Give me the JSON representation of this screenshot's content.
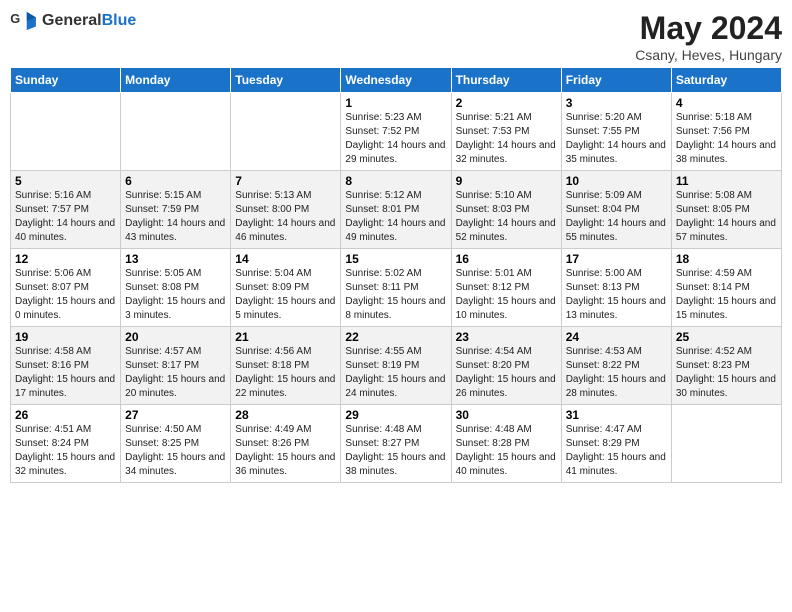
{
  "header": {
    "logo_general": "General",
    "logo_blue": "Blue",
    "month_year": "May 2024",
    "location": "Csany, Heves, Hungary"
  },
  "weekdays": [
    "Sunday",
    "Monday",
    "Tuesday",
    "Wednesday",
    "Thursday",
    "Friday",
    "Saturday"
  ],
  "weeks": [
    [
      {
        "day": "",
        "sunrise": "",
        "sunset": "",
        "daylight": ""
      },
      {
        "day": "",
        "sunrise": "",
        "sunset": "",
        "daylight": ""
      },
      {
        "day": "",
        "sunrise": "",
        "sunset": "",
        "daylight": ""
      },
      {
        "day": "1",
        "sunrise": "Sunrise: 5:23 AM",
        "sunset": "Sunset: 7:52 PM",
        "daylight": "Daylight: 14 hours and 29 minutes."
      },
      {
        "day": "2",
        "sunrise": "Sunrise: 5:21 AM",
        "sunset": "Sunset: 7:53 PM",
        "daylight": "Daylight: 14 hours and 32 minutes."
      },
      {
        "day": "3",
        "sunrise": "Sunrise: 5:20 AM",
        "sunset": "Sunset: 7:55 PM",
        "daylight": "Daylight: 14 hours and 35 minutes."
      },
      {
        "day": "4",
        "sunrise": "Sunrise: 5:18 AM",
        "sunset": "Sunset: 7:56 PM",
        "daylight": "Daylight: 14 hours and 38 minutes."
      }
    ],
    [
      {
        "day": "5",
        "sunrise": "Sunrise: 5:16 AM",
        "sunset": "Sunset: 7:57 PM",
        "daylight": "Daylight: 14 hours and 40 minutes."
      },
      {
        "day": "6",
        "sunrise": "Sunrise: 5:15 AM",
        "sunset": "Sunset: 7:59 PM",
        "daylight": "Daylight: 14 hours and 43 minutes."
      },
      {
        "day": "7",
        "sunrise": "Sunrise: 5:13 AM",
        "sunset": "Sunset: 8:00 PM",
        "daylight": "Daylight: 14 hours and 46 minutes."
      },
      {
        "day": "8",
        "sunrise": "Sunrise: 5:12 AM",
        "sunset": "Sunset: 8:01 PM",
        "daylight": "Daylight: 14 hours and 49 minutes."
      },
      {
        "day": "9",
        "sunrise": "Sunrise: 5:10 AM",
        "sunset": "Sunset: 8:03 PM",
        "daylight": "Daylight: 14 hours and 52 minutes."
      },
      {
        "day": "10",
        "sunrise": "Sunrise: 5:09 AM",
        "sunset": "Sunset: 8:04 PM",
        "daylight": "Daylight: 14 hours and 55 minutes."
      },
      {
        "day": "11",
        "sunrise": "Sunrise: 5:08 AM",
        "sunset": "Sunset: 8:05 PM",
        "daylight": "Daylight: 14 hours and 57 minutes."
      }
    ],
    [
      {
        "day": "12",
        "sunrise": "Sunrise: 5:06 AM",
        "sunset": "Sunset: 8:07 PM",
        "daylight": "Daylight: 15 hours and 0 minutes."
      },
      {
        "day": "13",
        "sunrise": "Sunrise: 5:05 AM",
        "sunset": "Sunset: 8:08 PM",
        "daylight": "Daylight: 15 hours and 3 minutes."
      },
      {
        "day": "14",
        "sunrise": "Sunrise: 5:04 AM",
        "sunset": "Sunset: 8:09 PM",
        "daylight": "Daylight: 15 hours and 5 minutes."
      },
      {
        "day": "15",
        "sunrise": "Sunrise: 5:02 AM",
        "sunset": "Sunset: 8:11 PM",
        "daylight": "Daylight: 15 hours and 8 minutes."
      },
      {
        "day": "16",
        "sunrise": "Sunrise: 5:01 AM",
        "sunset": "Sunset: 8:12 PM",
        "daylight": "Daylight: 15 hours and 10 minutes."
      },
      {
        "day": "17",
        "sunrise": "Sunrise: 5:00 AM",
        "sunset": "Sunset: 8:13 PM",
        "daylight": "Daylight: 15 hours and 13 minutes."
      },
      {
        "day": "18",
        "sunrise": "Sunrise: 4:59 AM",
        "sunset": "Sunset: 8:14 PM",
        "daylight": "Daylight: 15 hours and 15 minutes."
      }
    ],
    [
      {
        "day": "19",
        "sunrise": "Sunrise: 4:58 AM",
        "sunset": "Sunset: 8:16 PM",
        "daylight": "Daylight: 15 hours and 17 minutes."
      },
      {
        "day": "20",
        "sunrise": "Sunrise: 4:57 AM",
        "sunset": "Sunset: 8:17 PM",
        "daylight": "Daylight: 15 hours and 20 minutes."
      },
      {
        "day": "21",
        "sunrise": "Sunrise: 4:56 AM",
        "sunset": "Sunset: 8:18 PM",
        "daylight": "Daylight: 15 hours and 22 minutes."
      },
      {
        "day": "22",
        "sunrise": "Sunrise: 4:55 AM",
        "sunset": "Sunset: 8:19 PM",
        "daylight": "Daylight: 15 hours and 24 minutes."
      },
      {
        "day": "23",
        "sunrise": "Sunrise: 4:54 AM",
        "sunset": "Sunset: 8:20 PM",
        "daylight": "Daylight: 15 hours and 26 minutes."
      },
      {
        "day": "24",
        "sunrise": "Sunrise: 4:53 AM",
        "sunset": "Sunset: 8:22 PM",
        "daylight": "Daylight: 15 hours and 28 minutes."
      },
      {
        "day": "25",
        "sunrise": "Sunrise: 4:52 AM",
        "sunset": "Sunset: 8:23 PM",
        "daylight": "Daylight: 15 hours and 30 minutes."
      }
    ],
    [
      {
        "day": "26",
        "sunrise": "Sunrise: 4:51 AM",
        "sunset": "Sunset: 8:24 PM",
        "daylight": "Daylight: 15 hours and 32 minutes."
      },
      {
        "day": "27",
        "sunrise": "Sunrise: 4:50 AM",
        "sunset": "Sunset: 8:25 PM",
        "daylight": "Daylight: 15 hours and 34 minutes."
      },
      {
        "day": "28",
        "sunrise": "Sunrise: 4:49 AM",
        "sunset": "Sunset: 8:26 PM",
        "daylight": "Daylight: 15 hours and 36 minutes."
      },
      {
        "day": "29",
        "sunrise": "Sunrise: 4:48 AM",
        "sunset": "Sunset: 8:27 PM",
        "daylight": "Daylight: 15 hours and 38 minutes."
      },
      {
        "day": "30",
        "sunrise": "Sunrise: 4:48 AM",
        "sunset": "Sunset: 8:28 PM",
        "daylight": "Daylight: 15 hours and 40 minutes."
      },
      {
        "day": "31",
        "sunrise": "Sunrise: 4:47 AM",
        "sunset": "Sunset: 8:29 PM",
        "daylight": "Daylight: 15 hours and 41 minutes."
      },
      {
        "day": "",
        "sunrise": "",
        "sunset": "",
        "daylight": ""
      }
    ]
  ]
}
